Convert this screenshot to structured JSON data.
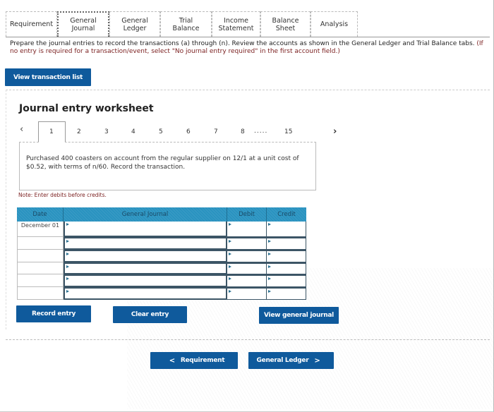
{
  "tabs": [
    {
      "label": "Requirement",
      "active": false
    },
    {
      "label": "General Journal",
      "active": true
    },
    {
      "label": "General Ledger",
      "active": false
    },
    {
      "label": "Trial Balance",
      "active": false
    },
    {
      "label": "Income Statement",
      "active": false
    },
    {
      "label": "Balance Sheet",
      "active": false
    },
    {
      "label": "Analysis",
      "active": false
    }
  ],
  "instructions": {
    "main": "Prepare the journal entries to record the transactions (a) through (n). Review the accounts as shown in the General Ledger and Trial Balance tabs.",
    "note": "(If no entry is required for a transaction/event, select \"No journal entry required\" in the first account field.)"
  },
  "buttons": {
    "view_transaction_list": "View transaction list",
    "record_entry": "Record entry",
    "clear_entry": "Clear entry",
    "view_general_journal": "View general journal",
    "prev_requirement": "Requirement",
    "next_general_ledger": "General Ledger"
  },
  "worksheet": {
    "title": "Journal entry worksheet",
    "pages": [
      "1",
      "2",
      "3",
      "4",
      "5",
      "6",
      "7",
      "8"
    ],
    "ellipsis": ".....",
    "last_page": "15",
    "active_page": 1,
    "description": "Purchased 400 coasters on account from the regular supplier on 12/1 at a unit cost of $0.52, with terms of n/60. Record the transaction.",
    "note": "Note: Enter debits before credits."
  },
  "table": {
    "headers": {
      "date": "Date",
      "account": "General Journal",
      "debit": "Debit",
      "credit": "Credit"
    },
    "rows": [
      {
        "date": "December 01",
        "account": "",
        "debit": "",
        "credit": ""
      },
      {
        "date": "",
        "account": "",
        "debit": "",
        "credit": ""
      },
      {
        "date": "",
        "account": "",
        "debit": "",
        "credit": ""
      },
      {
        "date": "",
        "account": "",
        "debit": "",
        "credit": ""
      },
      {
        "date": "",
        "account": "",
        "debit": "",
        "credit": ""
      },
      {
        "date": "",
        "account": "",
        "debit": "",
        "credit": ""
      }
    ]
  },
  "icons": {
    "prev": "‹",
    "next": "›",
    "chevron_left": "<",
    "chevron_right": ">"
  },
  "colors": {
    "primary_button": "#0f5a9c",
    "table_header": "#2a93c0",
    "note_red": "#7a1f1f"
  }
}
